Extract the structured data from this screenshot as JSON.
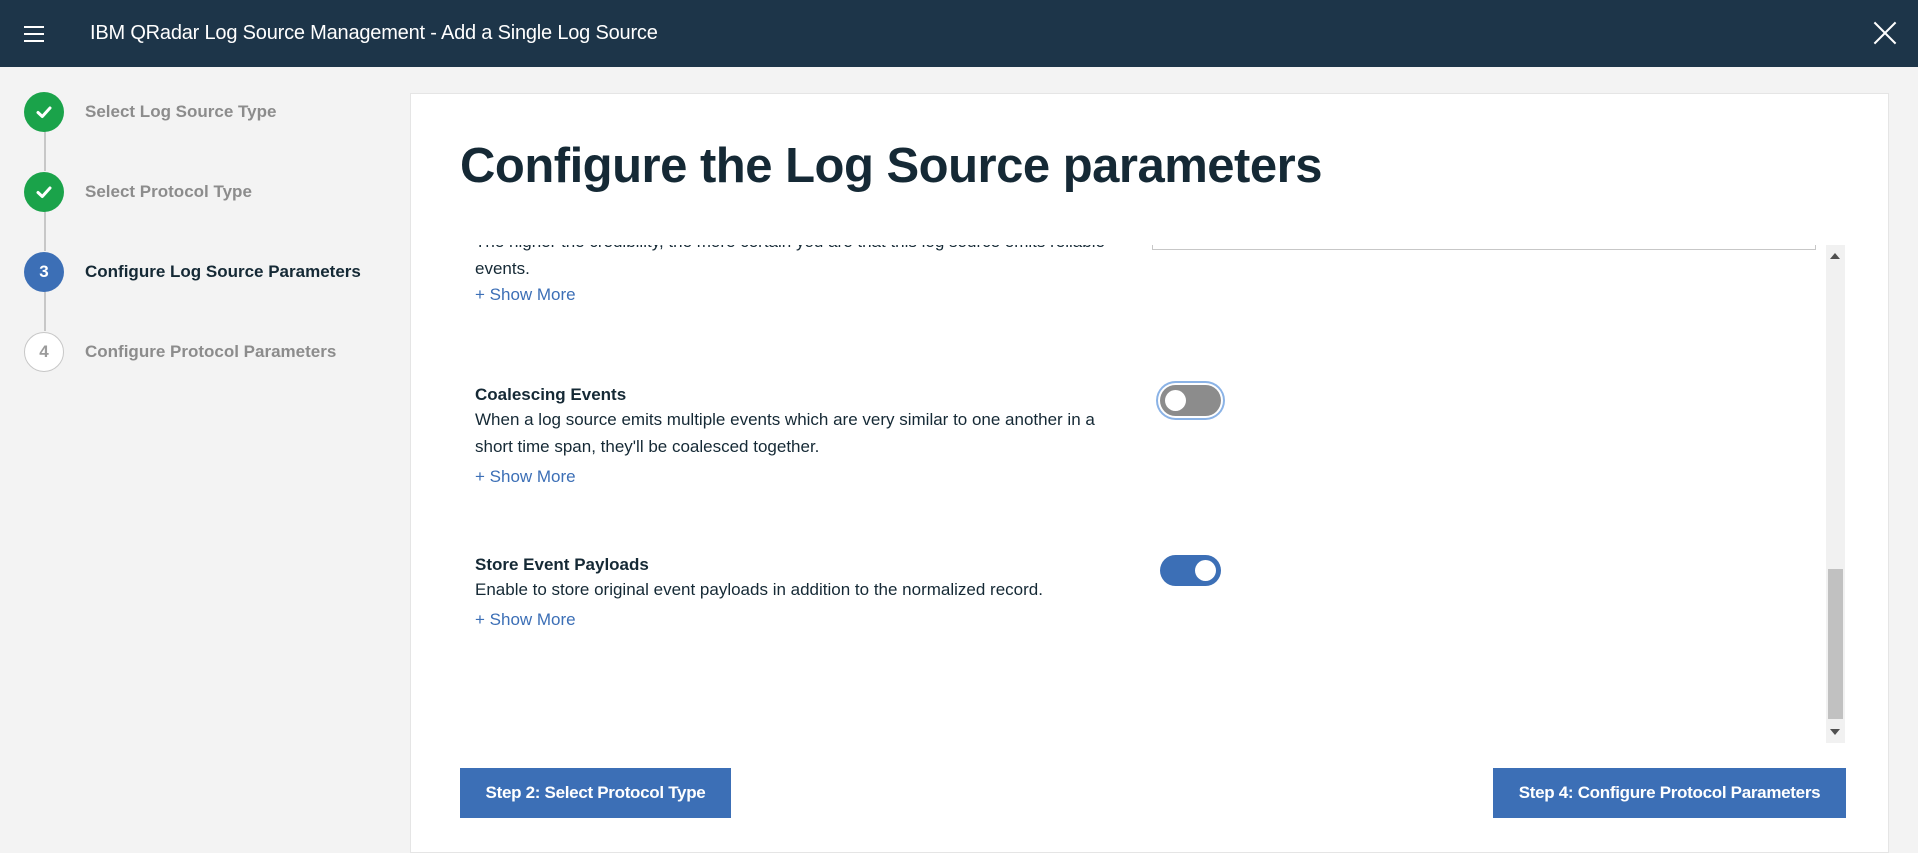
{
  "header": {
    "title": "IBM QRadar Log Source Management - Add a Single Log Source",
    "menu_icon": "hamburger-menu-icon",
    "close_icon": "close-icon"
  },
  "stepper": {
    "steps": [
      {
        "number": "1",
        "label": "Select Log Source Type",
        "status": "complete"
      },
      {
        "number": "2",
        "label": "Select Protocol Type",
        "status": "complete"
      },
      {
        "number": "3",
        "label": "Configure Log Source Parameters",
        "status": "current"
      },
      {
        "number": "4",
        "label": "Configure Protocol Parameters",
        "status": "pending"
      }
    ]
  },
  "main": {
    "title": "Configure the Log Source parameters",
    "credibility": {
      "desc": "The higher the credibility, the more certain you are that this log source emits reliable events.",
      "show_more": "+ Show More"
    },
    "coalescing": {
      "title": "Coalescing Events",
      "desc": "When a log source emits multiple events which are very similar to one another in a short time span, they'll be coalesced together.",
      "show_more": "+ Show More",
      "enabled": false
    },
    "payloads": {
      "title": "Store Event Payloads",
      "desc": "Enable to store original event payloads in addition to the normalized record.",
      "show_more": "+ Show More",
      "enabled": true
    }
  },
  "footer": {
    "prev_label": "Step 2: Select Protocol Type",
    "next_label": "Step 4: Configure Protocol Parameters"
  },
  "colors": {
    "header_bg": "#1d3549",
    "accent": "#3c6fb6",
    "success": "#1aa34a"
  }
}
